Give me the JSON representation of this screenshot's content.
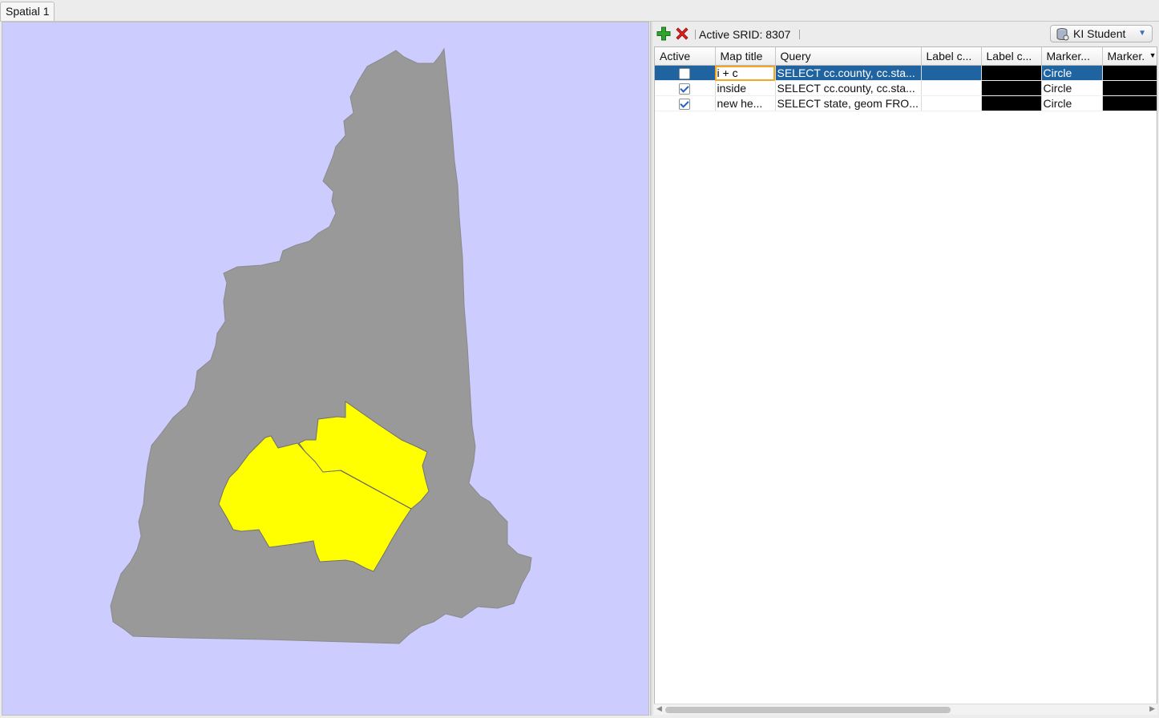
{
  "tabs": [
    {
      "label": "Spatial 1"
    }
  ],
  "toolbar": {
    "add_icon": "plus-icon",
    "remove_icon": "x-icon",
    "srid_text": "Active SRID: 8307",
    "connection_label": "KI Student"
  },
  "table": {
    "columns": [
      "Active",
      "Map title",
      "Query",
      "Label c...",
      "Label c...",
      "Marker...",
      "Marker."
    ],
    "rows": [
      {
        "active": false,
        "title": "i + c",
        "query": "SELECT cc.county, cc.sta...",
        "label_col": "",
        "marker": "Circle",
        "selected": true
      },
      {
        "active": true,
        "title": "inside",
        "query": "SELECT cc.county, cc.sta...",
        "label_col": "",
        "marker": "Circle",
        "selected": false
      },
      {
        "active": true,
        "title": "new he...",
        "query": "SELECT state, geom FRO...",
        "label_col": "",
        "marker": "Circle",
        "selected": false
      }
    ]
  },
  "colors": {
    "map_background": "#ccccff",
    "state_fill": "#999999",
    "highlight_fill": "#ffff00",
    "selection": "#1f63a0",
    "swatch": "#000000"
  }
}
